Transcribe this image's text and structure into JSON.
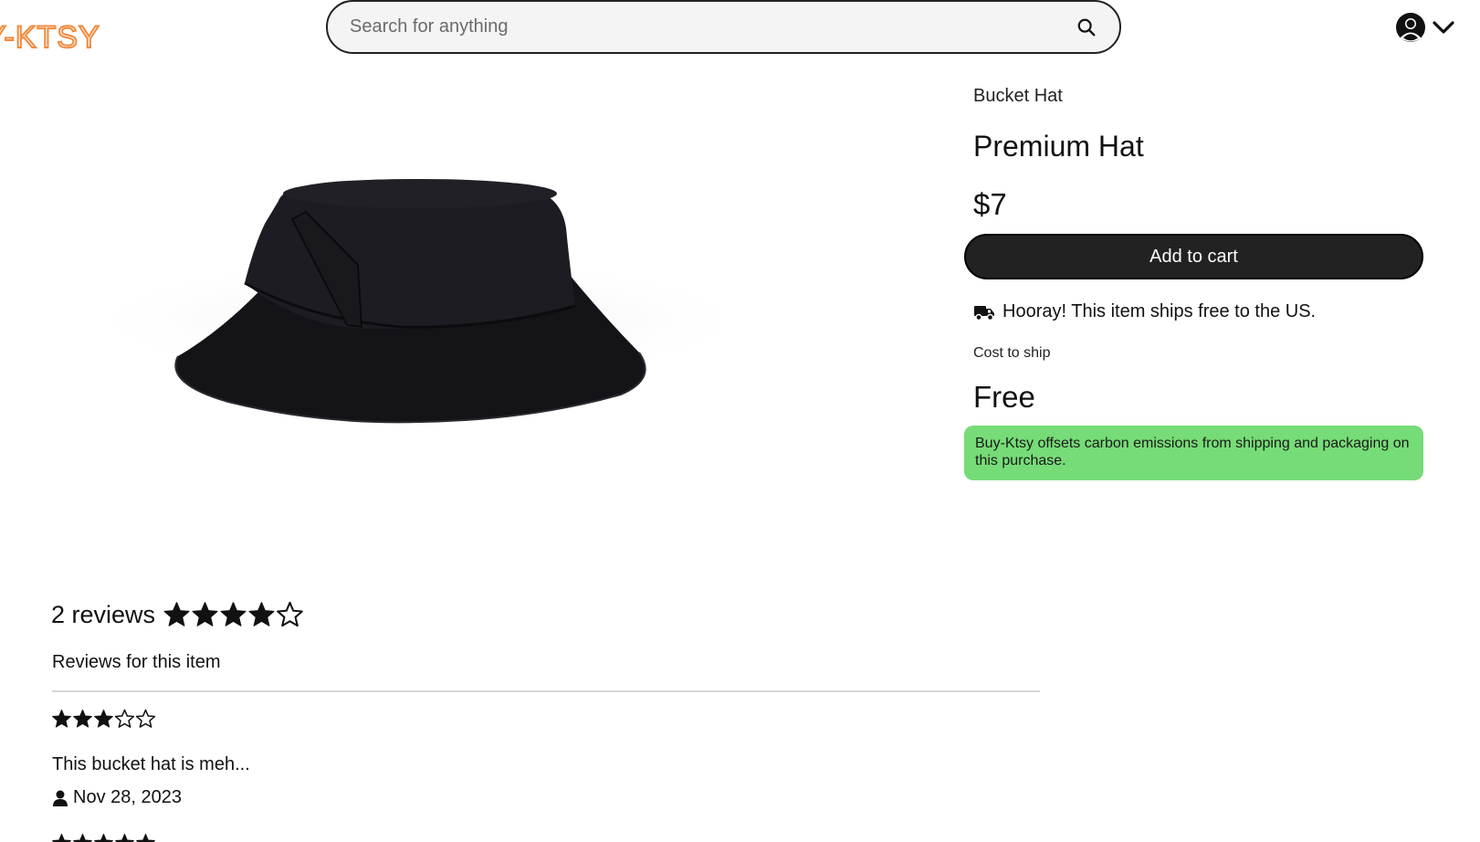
{
  "header": {
    "logo_text": "Y-KTSY",
    "search": {
      "placeholder": "Search for anything",
      "value": ""
    },
    "account_icon": "user-circle-icon",
    "menu_icon": "chevron-down-icon"
  },
  "product": {
    "category": "Bucket Hat",
    "title": "Premium Hat",
    "price": "$7",
    "add_to_cart_label": "Add to cart",
    "shipping_message": "Hooray! This item ships free to the US.",
    "shipping_icon": "truck-icon",
    "cost_to_ship_label": "Cost to ship",
    "cost_to_ship_value": "Free",
    "eco_message": "Buy-Ktsy offsets carbon emissions from shipping and packaging on this purchase.",
    "image_alt": "black bucket hat"
  },
  "reviews": {
    "count_label": "2 reviews",
    "average_rating": 4,
    "max_rating": 5,
    "subtitle": "Reviews for this item",
    "items": [
      {
        "rating": 3,
        "text": "This bucket hat is meh...",
        "date": "Nov 28, 2023"
      },
      {
        "rating": 5
      }
    ]
  },
  "colors": {
    "logo": "#f28a3c",
    "button_bg": "#222222",
    "eco_bg": "#76dc77"
  }
}
